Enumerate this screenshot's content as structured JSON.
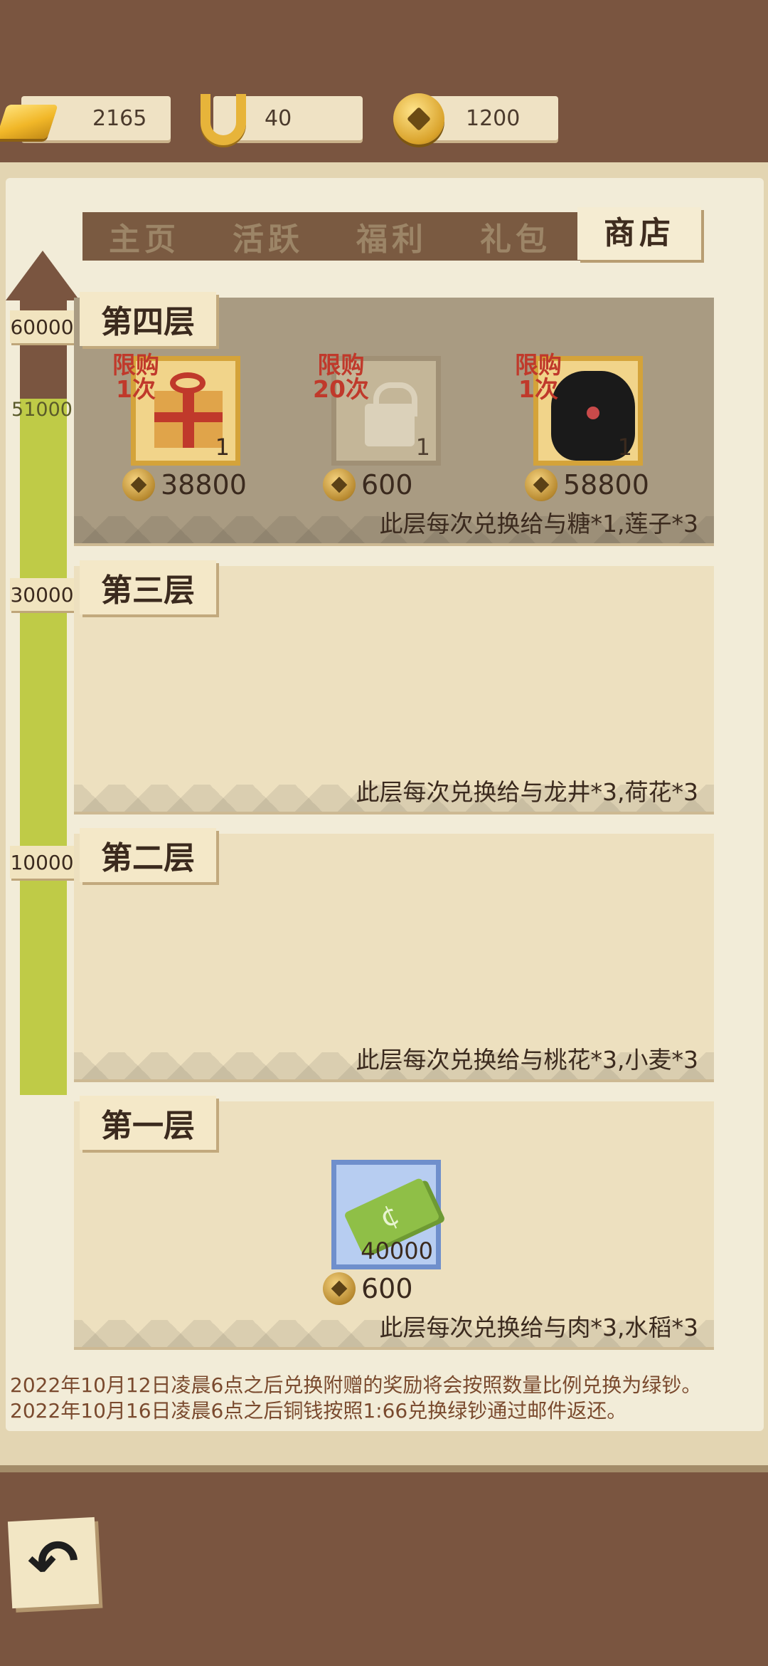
{
  "resources": [
    {
      "name": "gold-bar",
      "value": "2165"
    },
    {
      "name": "horseshoe",
      "value": "40"
    },
    {
      "name": "coin",
      "value": "1200"
    }
  ],
  "tabs": [
    "主页",
    "活跃",
    "福利",
    "礼包",
    "商店"
  ],
  "active_tab": "商店",
  "progress": {
    "milestones": [
      "60000",
      "30000",
      "10000"
    ],
    "current": "51000"
  },
  "floors": [
    {
      "title": "第四层",
      "note": "此层每次兑换给与糖*1,莲子*3",
      "items": [
        {
          "limit_line1": "限购",
          "limit_line2": "1次",
          "qty": "1",
          "price": "38800",
          "icon": "gift-box-icon"
        },
        {
          "limit_line1": "限购",
          "limit_line2": "20次",
          "qty": "1",
          "price": "600",
          "icon": "lock-icon"
        },
        {
          "limit_line1": "限购",
          "limit_line2": "1次",
          "qty": "1",
          "price": "58800",
          "icon": "black-dog-icon"
        }
      ]
    },
    {
      "title": "第三层",
      "note": "此层每次兑换给与龙井*3,荷花*3"
    },
    {
      "title": "第二层",
      "note": "此层每次兑换给与桃花*3,小麦*3"
    },
    {
      "title": "第一层",
      "note": "此层每次兑换给与肉*3,水稻*3",
      "items": [
        {
          "qty": "40000",
          "price": "600",
          "icon": "green-cash-icon"
        }
      ]
    }
  ],
  "footer": {
    "line1": "2022年10月12日凌晨6点之后兑换附赠的奖励将会按照数量比例兑换为绿钞。",
    "line2": "2022年10月16日凌晨6点之后铜钱按照1:66兑换绿钞通过邮件返还。"
  }
}
